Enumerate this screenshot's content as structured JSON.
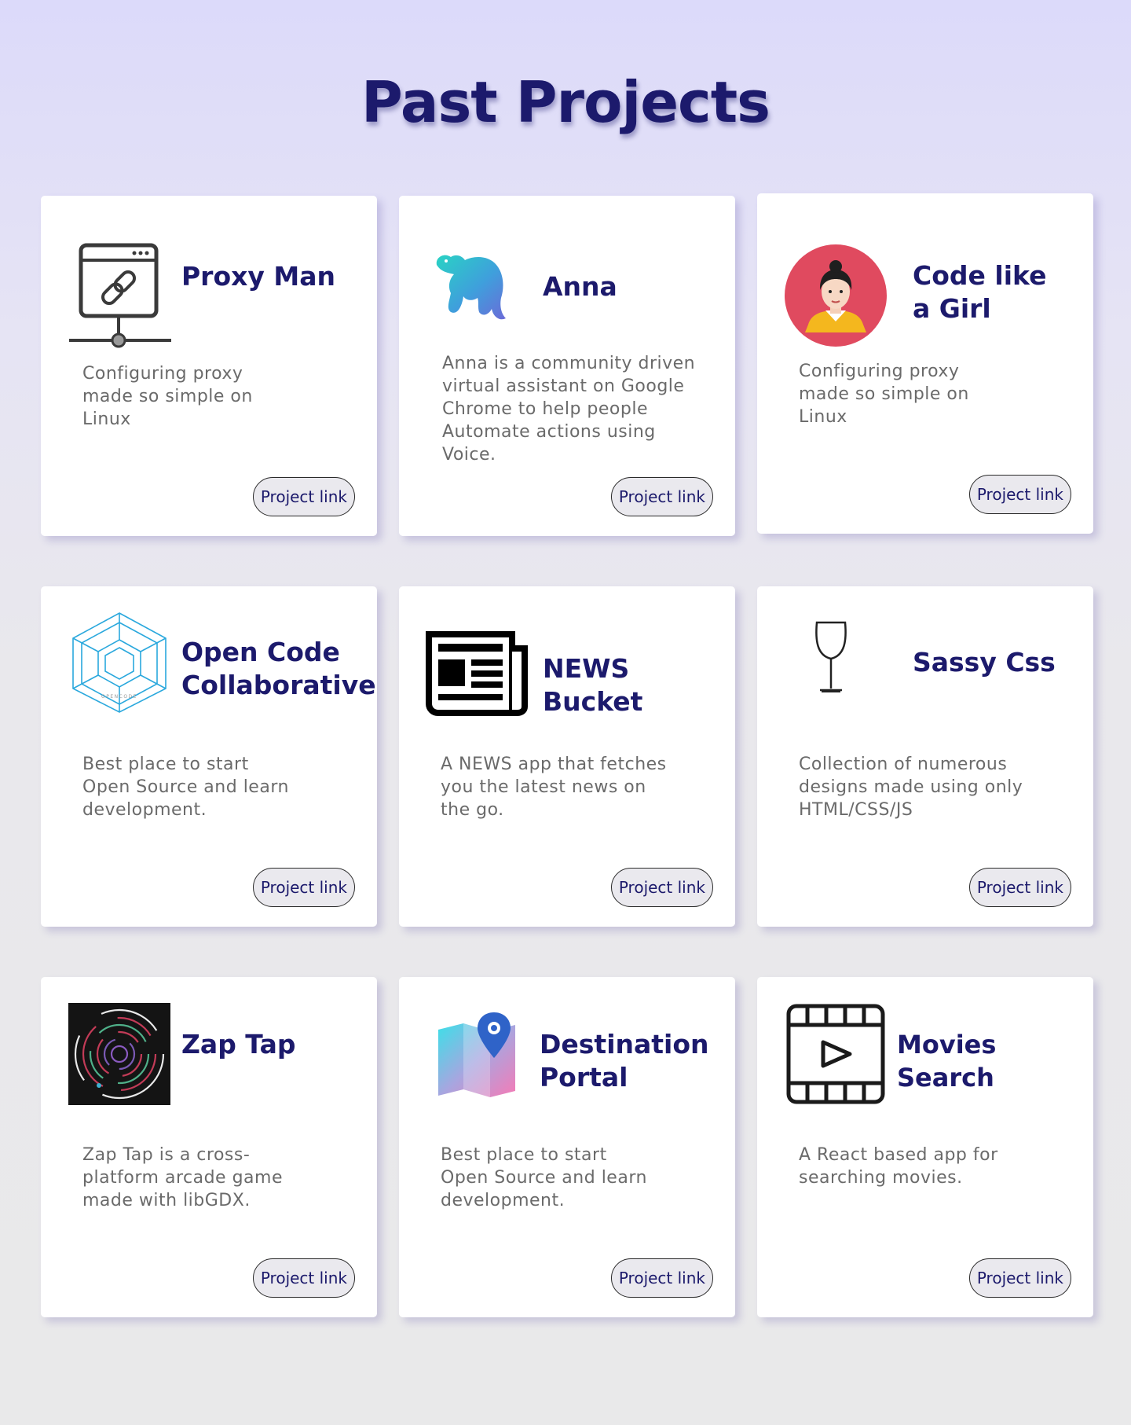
{
  "header": {
    "title": "Past Projects"
  },
  "link_label": "Project link",
  "projects": [
    {
      "title": "Proxy Man",
      "description": "Configuring proxy made so simple on Linux",
      "icon": "network-link-icon"
    },
    {
      "title": "Anna",
      "description": "Anna is a community driven virtual assistant on Google Chrome to help people Automate actions using Voice.",
      "icon": "elephant-icon"
    },
    {
      "title": "Code like a Girl",
      "description": "Configuring proxy made so simple on Linux",
      "icon": "girl-avatar-icon"
    },
    {
      "title": "Open Code Collaborative",
      "description": "Best place to start Open Source and learn development.",
      "icon": "opencode-hexagon-icon",
      "icon_text": "OPENCODE"
    },
    {
      "title": "NEWS Bucket",
      "description": "A NEWS app that fetches you the latest news on the go.",
      "icon": "newspaper-icon"
    },
    {
      "title": "Sassy Css",
      "description": "Collection of numerous designs made using only HTML/CSS/JS",
      "icon": "wine-glass-icon"
    },
    {
      "title": "Zap Tap",
      "description": "Zap Tap is a cross-platform arcade game made with libGDX.",
      "icon": "zap-tap-logo-icon"
    },
    {
      "title": "Destination Portal",
      "description": "Best place to start Open Source and learn development.",
      "icon": "map-pin-icon"
    },
    {
      "title": "Movies Search",
      "description": "A React based app for searching movies.",
      "icon": "film-play-icon"
    }
  ]
}
